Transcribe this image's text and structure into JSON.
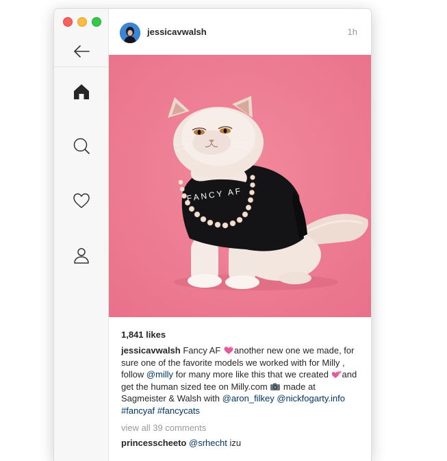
{
  "window": {
    "controls": [
      "close",
      "minimize",
      "zoom"
    ]
  },
  "sidebar": {
    "back_icon": "arrow-left-icon",
    "nav": [
      {
        "name": "home",
        "icon": "home-icon",
        "active": true
      },
      {
        "name": "search",
        "icon": "search-icon",
        "active": false
      },
      {
        "name": "activity",
        "icon": "heart-icon",
        "active": false
      },
      {
        "name": "profile",
        "icon": "person-icon",
        "active": false
      }
    ]
  },
  "post": {
    "username": "jessicavwalsh",
    "time": "1h",
    "photo_text": "FANCY AF",
    "likes": "1,841 likes",
    "caption": {
      "username": "jessicavwalsh",
      "part1": " Fancy AF ",
      "part2": "another new one we made, for sure one of the favorite models we worked with for Milly , follow ",
      "mention1": "@milly",
      "part3": " for many more like this that we created ",
      "part4": "and get the human sized tee on Milly.com ",
      "part5": " made at Sagmeister & Walsh with ",
      "mention2": "@aron_filkey",
      "mention3": "@nickfogarty.info",
      "hashtag1": "#fancyaf",
      "hashtag2": "#fancycats"
    },
    "view_all": "view all 39 comments",
    "comment": {
      "username": "princesscheeto",
      "mention": "@srhecht",
      "text": " izu"
    }
  },
  "colors": {
    "photo_bg": "#ee7d90",
    "link": "#003569",
    "meta_gray": "#999999",
    "text": "#262626"
  }
}
